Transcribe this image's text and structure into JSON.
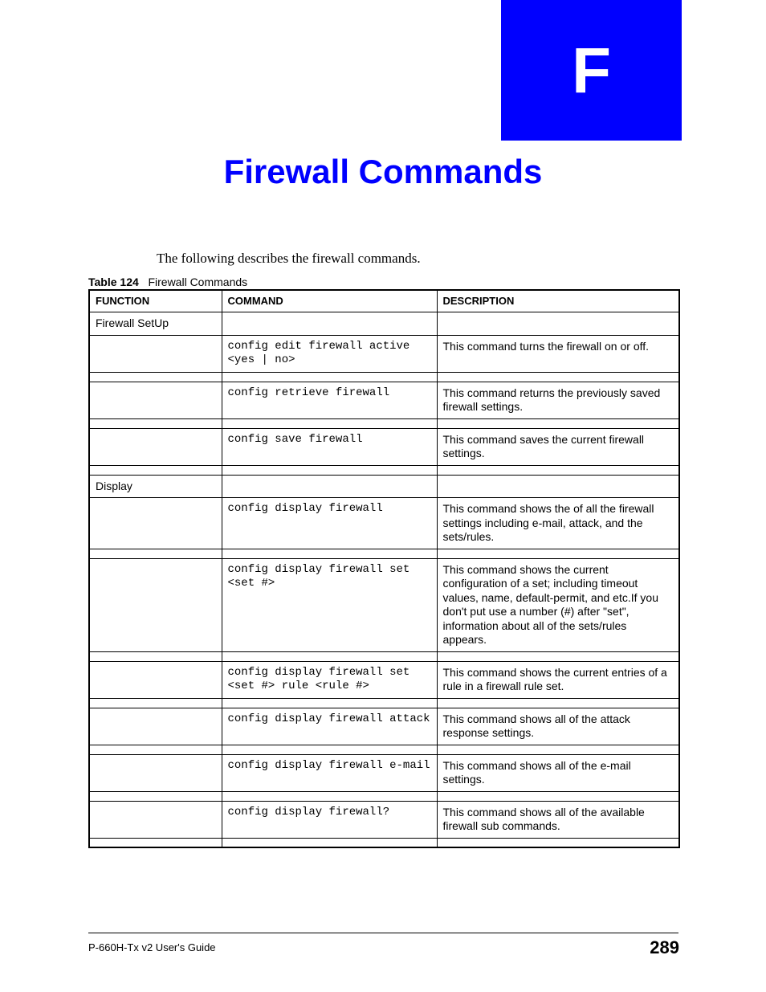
{
  "appendix_letter": "F",
  "page_title": "Firewall Commands",
  "intro": "The following describes the firewall commands.",
  "table": {
    "caption_label": "Table 124",
    "caption_text": "Firewall Commands",
    "headers": {
      "function": "FUNCTION",
      "command": "COMMAND",
      "description": "DESCRIPTION"
    },
    "rows": [
      {
        "function": "Firewall SetUp",
        "command": "",
        "description": ""
      },
      {
        "function": "",
        "command": "config edit firewall active <yes | no>",
        "description": "This command turns the firewall on or off."
      },
      {
        "spacer": true
      },
      {
        "function": "",
        "command": "config retrieve firewall",
        "description": "This command returns the previously saved firewall settings."
      },
      {
        "spacer": true
      },
      {
        "function": "",
        "command": "config save firewall",
        "description": "This command saves the current firewall settings."
      },
      {
        "spacer": true
      },
      {
        "function": "Display",
        "command": "",
        "description": ""
      },
      {
        "function": "",
        "command": "config display firewall",
        "description": "This command shows the of all the firewall settings including e-mail, attack, and the sets/rules."
      },
      {
        "spacer": true
      },
      {
        "function": "",
        "command": "config display firewall set <set #>",
        "description": "This command shows the current configuration of a set; including timeout values, name, default-permit, and etc.If you don't put use a number (#) after \"set\", information about all of the sets/rules appears."
      },
      {
        "spacer": true
      },
      {
        "function": "",
        "command": "config display firewall set <set #> rule <rule #>",
        "description": "This command shows the current entries of a rule in a firewall rule set."
      },
      {
        "spacer": true
      },
      {
        "function": "",
        "command": "config display firewall attack",
        "description": "This command shows all of the attack response settings."
      },
      {
        "spacer": true
      },
      {
        "function": "",
        "command": "config display firewall e-mail",
        "description": "This command shows all of the e-mail settings."
      },
      {
        "spacer": true
      },
      {
        "function": "",
        "command": "config display firewall?",
        "description": "This command shows all of the available firewall sub commands."
      },
      {
        "spacer": true
      }
    ]
  },
  "footer": {
    "guide": "P-660H-Tx v2 User's Guide",
    "page_number": "289"
  }
}
